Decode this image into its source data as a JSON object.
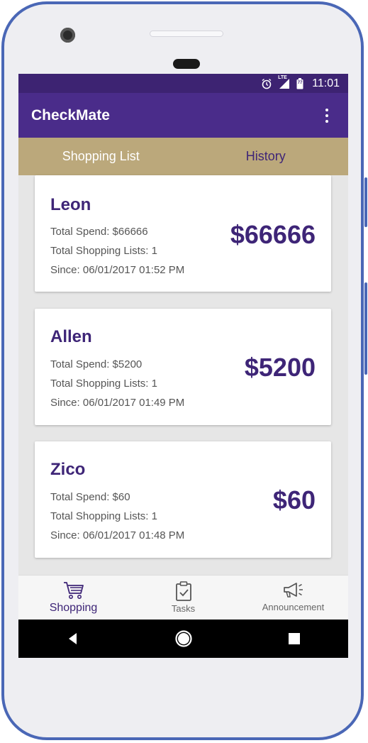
{
  "status_bar": {
    "time": "11:01",
    "icons": [
      "alarm-icon",
      "lte-signal-icon",
      "battery-icon"
    ],
    "network": "LTE",
    "battery_level": "77"
  },
  "app_bar": {
    "title": "CheckMate",
    "menu_icon": "overflow-menu-icon"
  },
  "tabs": [
    {
      "label": "Shopping List",
      "active": true
    },
    {
      "label": "History",
      "active": false
    }
  ],
  "cards": [
    {
      "name": "Leon",
      "total_spend": "Total Spend: $66666",
      "lists": "Total Shopping Lists: 1",
      "since": "Since: 06/01/2017 01:52 PM",
      "amount": "$66666"
    },
    {
      "name": "Allen",
      "total_spend": "Total Spend: $5200",
      "lists": "Total Shopping Lists: 1",
      "since": "Since: 06/01/2017 01:49 PM",
      "amount": "$5200"
    },
    {
      "name": "Zico",
      "total_spend": "Total Spend: $60",
      "lists": "Total Shopping Lists: 1",
      "since": "Since: 06/01/2017 01:48 PM",
      "amount": "$60"
    }
  ],
  "bottom_nav": [
    {
      "label": "Shopping",
      "icon": "cart-icon",
      "active": true
    },
    {
      "label": "Tasks",
      "icon": "clipboard-check-icon",
      "active": false
    },
    {
      "label": "Announcement",
      "icon": "megaphone-icon",
      "active": false
    }
  ],
  "system_nav": [
    "back-icon",
    "home-icon",
    "recents-icon"
  ],
  "colors": {
    "primary": "#4a2c8a",
    "primary_dark": "#3d2372",
    "tab_bar": "#bba87b",
    "accent_text": "#3e2577",
    "phone_frame": "#4a67b6"
  }
}
